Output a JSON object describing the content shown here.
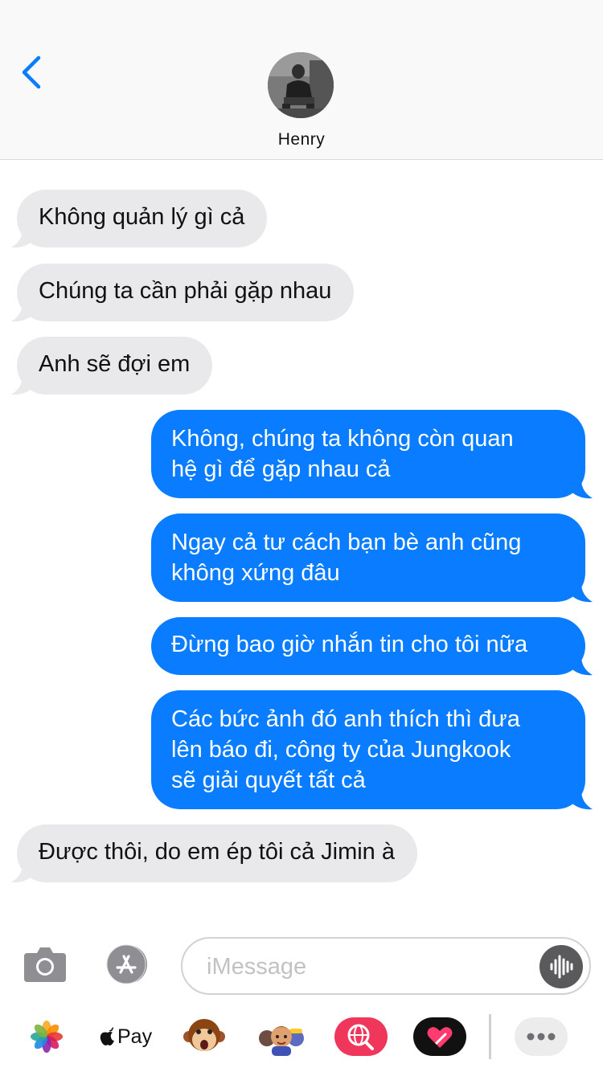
{
  "header": {
    "contact_name": "Henry"
  },
  "messages": [
    {
      "direction": "incoming",
      "text": "Không quản lý gì cả"
    },
    {
      "direction": "incoming",
      "text": "Chúng ta cần phải gặp nhau"
    },
    {
      "direction": "incoming",
      "text": "Anh sẽ đợi em"
    },
    {
      "direction": "outgoing",
      "lines": [
        "Không, chúng ta không còn quan",
        "hệ gì để gặp nhau cả"
      ]
    },
    {
      "direction": "outgoing",
      "lines": [
        "Ngay cả tư cách bạn bè anh cũng",
        "không xứng đâu"
      ]
    },
    {
      "direction": "outgoing",
      "text": "Đừng bao giờ nhắn tin cho tôi nữa"
    },
    {
      "direction": "outgoing",
      "lines": [
        "Các bức ảnh đó anh thích thì đưa",
        "lên báo đi, công ty của Jungkook",
        "sẽ giải quyết tất cả"
      ]
    },
    {
      "direction": "incoming",
      "text": "Được thôi, do em ép tôi cả Jimin à"
    }
  ],
  "input": {
    "placeholder": "iMessage",
    "value": ""
  },
  "drawer": {
    "applepay_label": "Pay"
  },
  "colors": {
    "outgoing_bubble": "#0a7cff",
    "incoming_bubble": "#e9e9eb",
    "accent": "#0a7cff",
    "battery": "#f7c600"
  },
  "icons": [
    "back-chevron-icon",
    "camera-icon",
    "app-store-icon",
    "audio-waveform-icon",
    "photos-icon",
    "apple-logo-icon",
    "monkey-animoji-icon",
    "memoji-icon",
    "web-search-icon",
    "digital-touch-icon",
    "more-icon"
  ]
}
